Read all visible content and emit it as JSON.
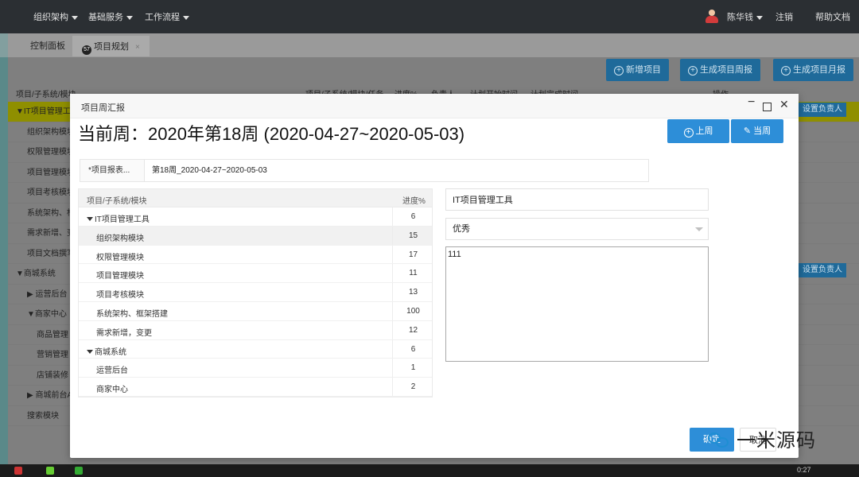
{
  "topbar": {
    "nav": [
      "组织架构",
      "基础服务",
      "工作流程"
    ],
    "user": "陈华钱",
    "logout": "注销",
    "help": "帮助文档"
  },
  "tabs": {
    "home": "控制面板",
    "active": "项目规划",
    "active_icon_text": "57",
    "close": "×"
  },
  "background": {
    "buttons": [
      "新增项目",
      "生成项目周报",
      "生成项目月报"
    ],
    "headers": [
      "项目/子系统/模块",
      "项目/子系统/模块/任务",
      "进度%",
      "负责人",
      "计划开始时间",
      "计划完成时间",
      "操作"
    ],
    "rows": [
      "▼IT项目管理工",
      "组织架构模块",
      "权限管理模块",
      "项目管理模块",
      "项目考核模块",
      "系统架构、框",
      "需求新增、变",
      "项目文档撰写",
      "▼商城系统",
      "▶ 运营后台",
      "▼商家中心",
      "商品管理",
      "营销管理",
      "店铺装修",
      "▶ 商城前台A",
      "搜索模块"
    ],
    "assign": "设置负责人"
  },
  "modal": {
    "title": "项目周汇报",
    "week_title": "当前周：2020年第18周 (2020-04-27~2020-05-03)",
    "prev_week": "上周",
    "current_week": "当周",
    "report_label": "*项目报表...",
    "report_value": "第18周_2020-04-27~2020-05-03",
    "tree_header": {
      "name": "项目/子系统/模块",
      "progress": "进度%"
    },
    "tree_rows": [
      {
        "name": "IT项目管理工具",
        "progress": "6",
        "level": 0,
        "expanded": true
      },
      {
        "name": "组织架构模块",
        "progress": "15",
        "level": 1,
        "selected": true
      },
      {
        "name": "权限管理模块",
        "progress": "17",
        "level": 1
      },
      {
        "name": "项目管理模块",
        "progress": "11",
        "level": 1
      },
      {
        "name": "项目考核模块",
        "progress": "13",
        "level": 1
      },
      {
        "name": "系统架构、框架搭建",
        "progress": "100",
        "level": 1
      },
      {
        "name": "需求新增，变更",
        "progress": "12",
        "level": 1
      },
      {
        "name": "商城系统",
        "progress": "6",
        "level": 0,
        "expanded": true
      },
      {
        "name": "运营后台",
        "progress": "1",
        "level": 1
      },
      {
        "name": "商家中心",
        "progress": "2",
        "level": 1
      }
    ],
    "detail": {
      "project_name": "IT项目管理工具",
      "rating": "优秀",
      "comment": "111"
    },
    "ok": "确定",
    "cancel": "取消"
  },
  "watermark": "一米源码",
  "taskbar": {
    "clock": "0:27"
  },
  "colors": {
    "primary": "#2d8ed8",
    "topbar": "#2b2f33",
    "highlight": "#8f8f00"
  }
}
